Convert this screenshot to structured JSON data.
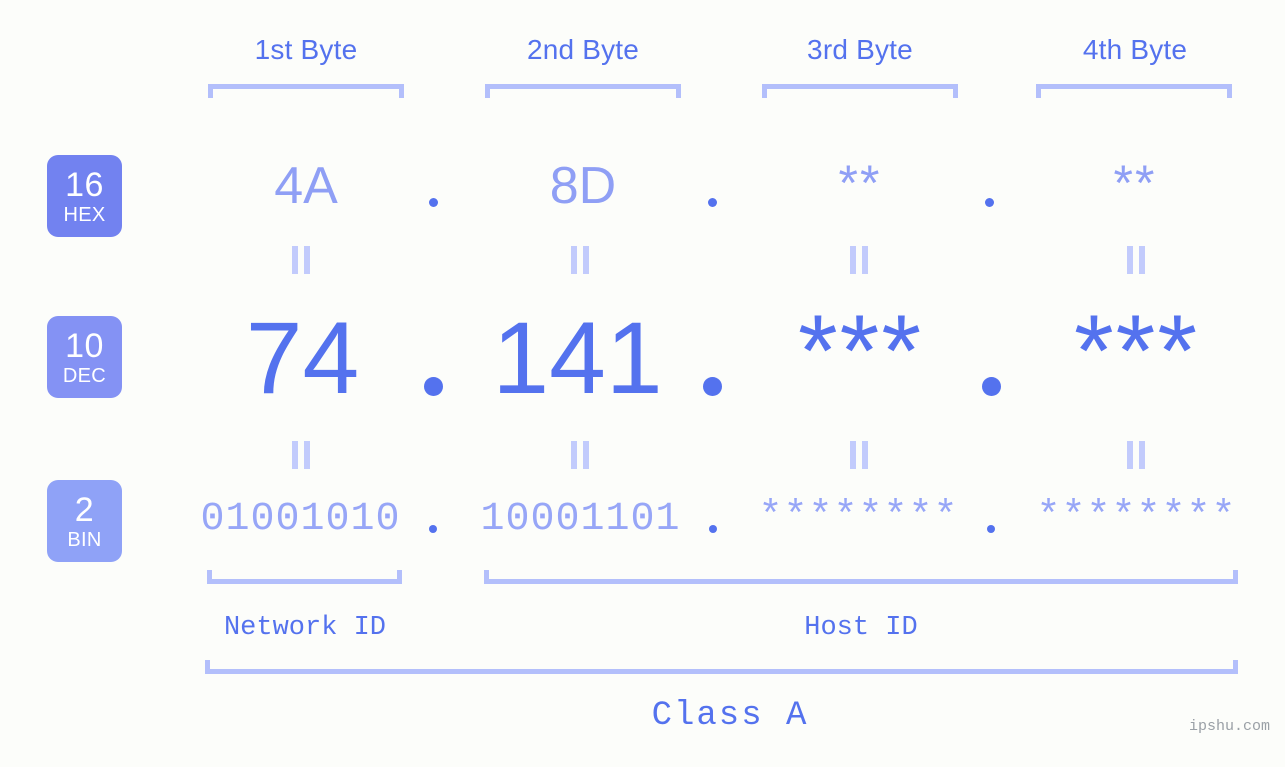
{
  "meta": {
    "watermark": "ipshu.com",
    "accent_strong": "#5472ee",
    "accent_mid": "#8f9ff5",
    "accent_light": "#b3bffb",
    "background": "#fcfdfa"
  },
  "byte_headers": [
    {
      "label": "1st Byte"
    },
    {
      "label": "2nd Byte"
    },
    {
      "label": "3rd Byte"
    },
    {
      "label": "4th Byte"
    }
  ],
  "bases": [
    {
      "num": "16",
      "label": "HEX",
      "color": "#7282f0"
    },
    {
      "num": "10",
      "label": "DEC",
      "color": "#8492f4"
    },
    {
      "num": "2",
      "label": "BIN",
      "color": "#8fa2f7"
    }
  ],
  "rows": {
    "hex": {
      "base_num": "16",
      "base_label": "HEX",
      "values": [
        "4A",
        "8D",
        "**",
        "**"
      ],
      "separator": "."
    },
    "dec": {
      "base_num": "10",
      "base_label": "DEC",
      "values": [
        "74",
        "141",
        "***",
        "***"
      ],
      "separator": "."
    },
    "bin": {
      "base_num": "2",
      "base_label": "BIN",
      "values": [
        "01001010",
        "10001101",
        "********",
        "********"
      ],
      "separator": "."
    }
  },
  "equals_marks": {
    "glyph": "||",
    "count_per_row": 4
  },
  "id_sections": [
    {
      "label": "Network ID"
    },
    {
      "label": "Host ID"
    }
  ],
  "class": {
    "label": "Class A"
  }
}
